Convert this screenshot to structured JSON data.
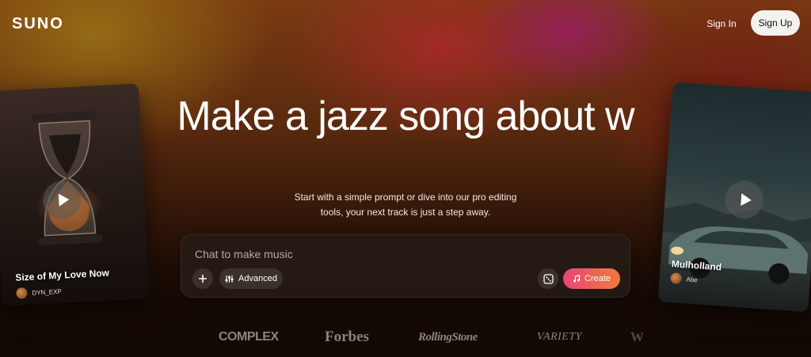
{
  "header": {
    "logo": "SUNO",
    "sign_in_label": "Sign In",
    "sign_up_label": "Sign Up"
  },
  "hero": {
    "headline": "Make a jazz song about w",
    "subtext": "Start with a simple prompt or dive into our pro editing tools, your next track is just a step away."
  },
  "chat": {
    "placeholder": "Chat to make music",
    "advanced_label": "Advanced",
    "create_label": "Create"
  },
  "cards": [
    {
      "title": "Size of My Love Now",
      "artist": "DYN_EXP",
      "icon": "hourglass-artwork"
    },
    {
      "title": "Mulholland",
      "artist": "Abe",
      "icon": "car-artwork"
    }
  ],
  "press_logos": [
    "COMPLEX",
    "Forbes",
    "RollingStone",
    "VARIETY",
    "W"
  ],
  "colors": {
    "create_gradient_start": "#e8457a",
    "create_gradient_end": "#f07a3a",
    "sign_up_bg": "#f4f2ee"
  }
}
